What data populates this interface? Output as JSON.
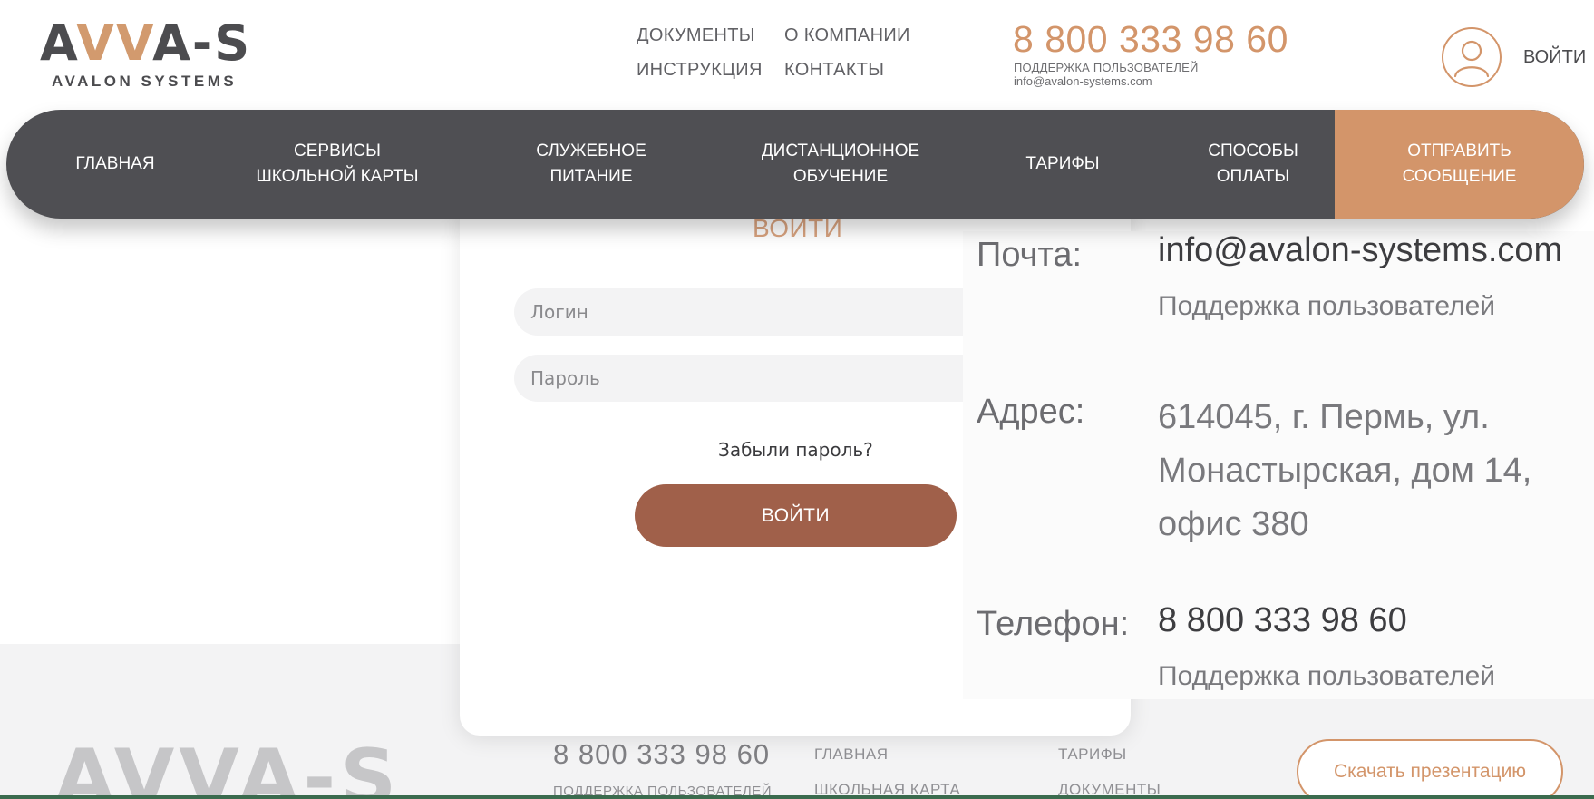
{
  "header": {
    "logo": {
      "part1": "A",
      "accent": "VV",
      "part2": "A-S",
      "subtitle": "AVALON SYSTEMS"
    },
    "top_links": {
      "documents": "ДОКУМЕНТЫ",
      "about": "О КОМПАНИИ",
      "instructions": "ИНСТРУКЦИЯ",
      "contacts": "КОНТАКТЫ"
    },
    "phone": "8 800 333 98 60",
    "support": "ПОДДЕРЖКА ПОЛЬЗОВАТЕЛЕЙ",
    "email": "info@avalon-systems.com",
    "user_icon": "user-icon",
    "login": "ВОЙТИ"
  },
  "nav": {
    "home": "ГЛАВНАЯ",
    "services": "СЕРВИСЫ\nШКОЛЬНОЙ КАРТЫ",
    "food": "СЛУЖЕБНОЕ\nПИТАНИЕ",
    "distance": "ДИСТАНЦИОННОЕ\nОБУЧЕНИЕ",
    "tariffs": "ТАРИФЫ",
    "payment": "СПОСОБЫ\nОПЛАТЫ",
    "send_message": "ОТПРАВИТЬ\nСООБЩЕНИЕ"
  },
  "login_form": {
    "title": "ВОЙТИ",
    "login_placeholder": "Логин",
    "password_placeholder": "Пароль",
    "forgot": "Забыли пароль?",
    "submit": "ВОЙТИ"
  },
  "contact": {
    "mail_label": "Почта:",
    "mail_value": "info@avalon-systems.com",
    "mail_sub": "Поддержка пользователей",
    "address_label": "Адрес:",
    "address_line1": "614045, г. Пермь, ул.",
    "address_line2": "Монастырская, дом 14,",
    "address_line3": "офис 380",
    "phone_label": "Телефон:",
    "phone_value": "8 800 333 98 60",
    "phone_sub": "Поддержка пользователей"
  },
  "footer": {
    "logo": "AVVA-S",
    "phone": "8 800 333 98 60",
    "support": "ПОДДЕРЖКА ПОЛЬЗОВАТЕЛЕЙ",
    "links": {
      "home": "ГЛАВНАЯ",
      "card": "ШКОЛЬНАЯ КАРТА",
      "tariffs": "ТАРИФЫ",
      "documents": "ДОКУМЕНТЫ"
    },
    "presentation": "Скачать презентацию"
  },
  "colors": {
    "accent": "#d3956a",
    "nav_bg": "#4f4f53",
    "button": "#a0604a",
    "text_dark": "#4c4c4f"
  }
}
